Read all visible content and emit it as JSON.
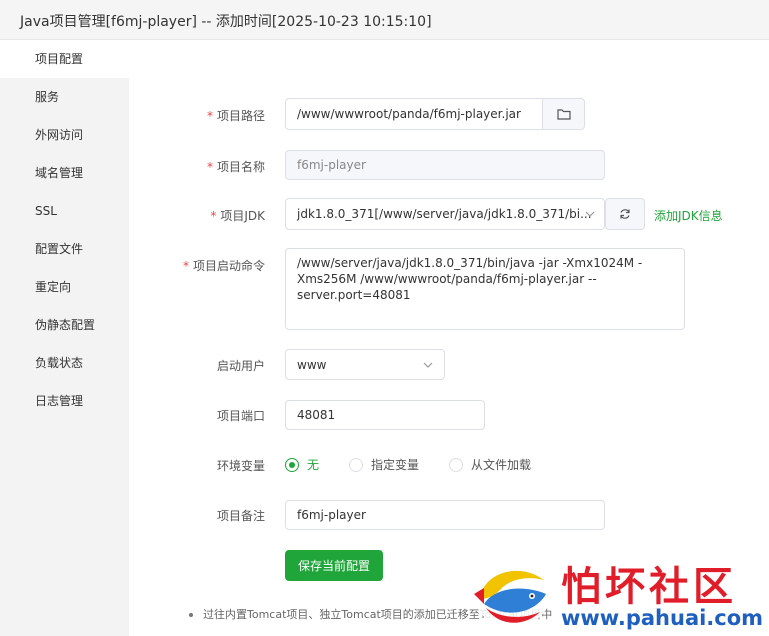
{
  "window": {
    "title": "Java项目管理[f6mj-player] -- 添加时间[2025-10-23 10:15:10]"
  },
  "sidebar": {
    "items": [
      {
        "label": "项目配置",
        "active": true
      },
      {
        "label": "服务"
      },
      {
        "label": "外网访问"
      },
      {
        "label": "域名管理"
      },
      {
        "label": "SSL"
      },
      {
        "label": "配置文件"
      },
      {
        "label": "重定向"
      },
      {
        "label": "伪静态配置"
      },
      {
        "label": "负载状态"
      },
      {
        "label": "日志管理"
      }
    ]
  },
  "form": {
    "path": {
      "label": "项目路径",
      "required": "*",
      "value": "/www/wwwroot/panda/f6mj-player.jar",
      "icon": "folder-icon"
    },
    "name": {
      "label": "项目名称",
      "required": "*",
      "value": "f6mj-player"
    },
    "jdk": {
      "label": "项目JDK",
      "required": "*",
      "value": "jdk1.8.0_371[/www/server/java/jdk1.8.0_371/bi...",
      "refresh_icon": "refresh-icon",
      "add_link": "添加JDK信息"
    },
    "command": {
      "label": "项目启动命令",
      "required": "*",
      "value": "/www/server/java/jdk1.8.0_371/bin/java -jar  -Xmx1024M -Xms256M /www/wwwroot/panda/f6mj-player.jar --server.port=48081"
    },
    "user": {
      "label": "启动用户",
      "value": "www"
    },
    "port": {
      "label": "项目端口",
      "value": "48081"
    },
    "env": {
      "label": "环境变量",
      "options": [
        "无",
        "指定变量",
        "从文件加载"
      ],
      "selected": "无"
    },
    "remark": {
      "label": "项目备注",
      "value": "f6mj-player"
    },
    "save_label": "保存当前配置"
  },
  "note": {
    "text": "过往内置Tomcat项目、独立Tomcat项目的添加已迁移至Tomcat项目中"
  },
  "watermark": {
    "title": "怕坏社区",
    "url": "www.pahuai.com"
  },
  "colors": {
    "accent": "#20a53a",
    "required": "#ef4444",
    "watermark_red": "#e11d2a",
    "watermark_blue": "#1f5fbf"
  }
}
